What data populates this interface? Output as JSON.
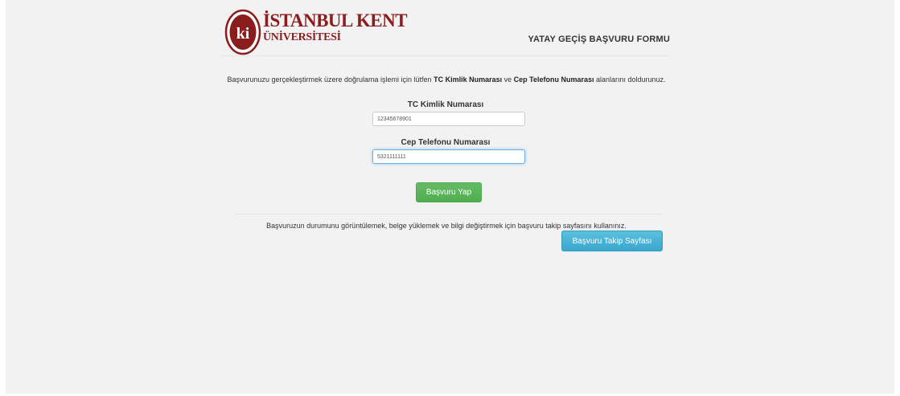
{
  "header": {
    "logo": {
      "line1": "İSTANBUL KENT",
      "line2": "ÜNİVERSİTESİ",
      "mark": "ki"
    },
    "form_title": "YATAY GEÇİŞ BAŞVURU FORMU"
  },
  "intro": {
    "part1": "Başvurunuzu gerçekleştirmek üzere doğrulama işlemi için lütfen ",
    "bold1": "TC Kimlik Numarası",
    "part2": " ve ",
    "bold2": "Cep Telefonu Numarası",
    "part3": " alanlarını doldurunuz."
  },
  "form": {
    "tc_label": "TC Kimlik Numarası",
    "tc_value": "12345678901",
    "phone_label": "Cep Telefonu Numarası",
    "phone_value": "5321111111",
    "submit_label": "Başvuru Yap"
  },
  "tracking": {
    "text": "Başvuruzun durumunu görüntülemek, belge yüklemek ve bilgi değiştirmek için başvuru takip sayfasını kullanınız.",
    "button_label": "Başvuru Takip Sayfası"
  },
  "colors": {
    "brand": "#8a1d1d",
    "success": "#5cb85c",
    "info": "#5bc0de",
    "focus": "#66afe9"
  }
}
